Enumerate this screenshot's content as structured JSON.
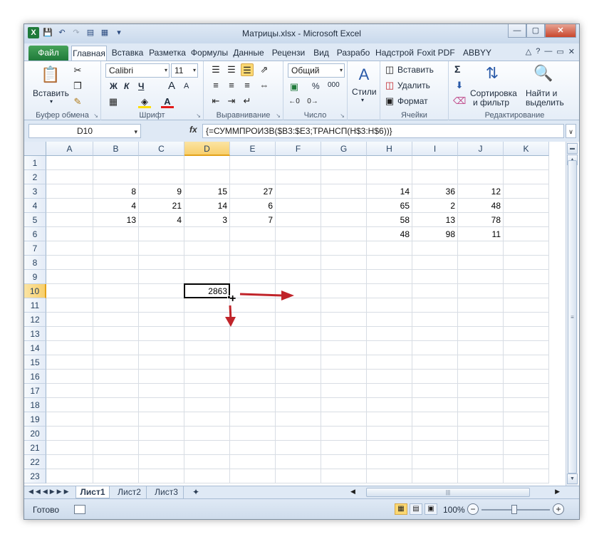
{
  "titlebar": {
    "title": "Матрицы.xlsx - Microsoft Excel",
    "app_icon": "excel-icon",
    "qat_icons": [
      "save-icon",
      "undo-icon",
      "redo-icon",
      "print-preview-icon",
      "calculator-icon",
      "customize-qat-icon"
    ],
    "win_min": "—",
    "win_max": "▢",
    "win_close": "✕"
  },
  "tabs": {
    "file": "Файл",
    "items": [
      "Главная",
      "Вставка",
      "Разметка",
      "Формулы",
      "Данные",
      "Рецензи",
      "Вид",
      "Разрабо",
      "Надстрой",
      "Foxit PDF",
      "ABBYY PD"
    ],
    "active": "Главная"
  },
  "ribbon": {
    "clipboard": {
      "label": "Буфер обмена",
      "paste": "Вставить"
    },
    "font": {
      "label": "Шрифт",
      "name": "Calibri",
      "size": "11",
      "bold": "Ж",
      "italic": "К",
      "underline": "Ч",
      "grow": "A",
      "shrink": "A"
    },
    "alignment": {
      "label": "Выравнивание"
    },
    "number": {
      "label": "Число",
      "format": "Общий",
      "percent": "%",
      "thousands": "000"
    },
    "styles": {
      "label": "Стили"
    },
    "cells": {
      "label": "Ячейки",
      "insert": "Вставить",
      "delete": "Удалить",
      "format": "Формат"
    },
    "editing": {
      "label": "Редактирование",
      "sort": "Сортировка\nи фильтр",
      "sort_line1": "Сортировка",
      "sort_line2": "и фильтр",
      "find_line1": "Найти и",
      "find_line2": "выделить",
      "sum": "Σ"
    }
  },
  "formula_bar": {
    "name_box": "D10",
    "fx": "fx",
    "formula": "{=СУММПРОИЗВ($B3:$E3;ТРАНСП(H$3:H$6))}"
  },
  "grid": {
    "columns": [
      "A",
      "B",
      "C",
      "D",
      "E",
      "F",
      "G",
      "H",
      "I",
      "J",
      "K"
    ],
    "rows": [
      "1",
      "2",
      "3",
      "4",
      "5",
      "6",
      "7",
      "8",
      "9",
      "10",
      "11",
      "12",
      "13",
      "14",
      "15",
      "16",
      "17",
      "18",
      "19",
      "20",
      "21",
      "22",
      "23"
    ],
    "selected_col": "D",
    "selected_row": "10",
    "matrix_left": [
      [
        "8",
        "9",
        "15",
        "27"
      ],
      [
        "4",
        "21",
        "14",
        "6"
      ],
      [
        "13",
        "4",
        "3",
        "7"
      ]
    ],
    "matrix_right": [
      [
        "14",
        "36",
        "12"
      ],
      [
        "65",
        "2",
        "48"
      ],
      [
        "58",
        "13",
        "78"
      ],
      [
        "48",
        "98",
        "11"
      ]
    ],
    "result": "2863"
  },
  "sheets": {
    "tabs": [
      "Лист1",
      "Лист2",
      "Лист3"
    ],
    "active": "Лист1"
  },
  "status": {
    "ready": "Готово",
    "zoom": "100%",
    "zoom_minus": "−",
    "zoom_plus": "+"
  },
  "colors": {
    "file_tab": "#1f7a3a",
    "selection_header": "#f8cf6c",
    "arrow": "#c0242a"
  }
}
